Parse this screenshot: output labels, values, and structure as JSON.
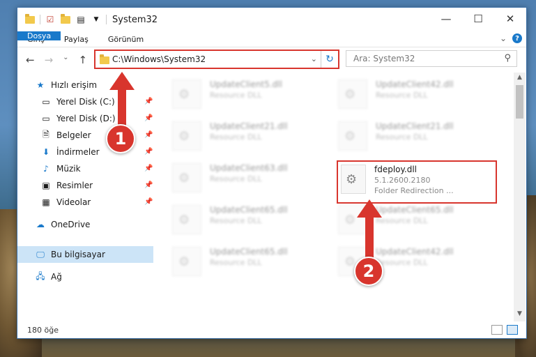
{
  "window": {
    "title": "System32",
    "controls": {
      "minimize": "—",
      "maximize": "☐",
      "close": "✕"
    }
  },
  "ribbon": {
    "tabs": [
      "Dosya",
      "Giriş",
      "Paylaş",
      "Görünüm"
    ],
    "expand": "⌄",
    "help": "?"
  },
  "address": {
    "path": "C:\\Windows\\System32",
    "search_placeholder": "Ara: System32"
  },
  "sidebar": {
    "items": [
      {
        "label": "Hızlı erişim",
        "icon": "star-icon",
        "pinned": false
      },
      {
        "label": "Yerel Disk (C:)",
        "icon": "drive-icon",
        "pinned": true
      },
      {
        "label": "Yerel Disk (D:)",
        "icon": "drive-icon",
        "pinned": true
      },
      {
        "label": "Belgeler",
        "icon": "document-icon",
        "pinned": true
      },
      {
        "label": "İndirmeler",
        "icon": "download-icon",
        "pinned": true
      },
      {
        "label": "Müzik",
        "icon": "music-icon",
        "pinned": true
      },
      {
        "label": "Resimler",
        "icon": "pictures-icon",
        "pinned": true
      },
      {
        "label": "Videolar",
        "icon": "video-icon",
        "pinned": true
      },
      {
        "label": "OneDrive",
        "icon": "cloud-icon",
        "pinned": false
      },
      {
        "label": "Bu bilgisayar",
        "icon": "computer-icon",
        "pinned": false
      },
      {
        "label": "Ağ",
        "icon": "network-icon",
        "pinned": false
      }
    ]
  },
  "files": [
    {
      "name": "UpdateClient5.dll",
      "type": "Resource DLL"
    },
    {
      "name": "UpdateClient42.dll",
      "type": "Resource DLL"
    },
    {
      "name": "UpdateClient21.dll",
      "type": "Resource DLL"
    },
    {
      "name": "UpdateClient21.dll",
      "type": "Resource DLL"
    },
    {
      "name": "UpdateClient63.dll",
      "type": "Resource DLL"
    },
    {
      "name": "fdeploy.dll",
      "version": "5.1.2600.2180",
      "type": "Folder Redirection ..."
    },
    {
      "name": "UpdateClient65.dll",
      "type": "Resource DLL"
    },
    {
      "name": "UpdateClient65.dll",
      "type": "Resource DLL"
    },
    {
      "name": "UpdateClient65.dll",
      "type": "Resource DLL"
    },
    {
      "name": "UpdateClient42.dll",
      "type": "Resource DLL"
    }
  ],
  "status": {
    "count": "180 öğe"
  },
  "annotations": {
    "marker1": "1",
    "marker2": "2"
  },
  "colors": {
    "accent": "#1979ca",
    "highlight": "#d8352d",
    "selection": "#cce4f7"
  }
}
